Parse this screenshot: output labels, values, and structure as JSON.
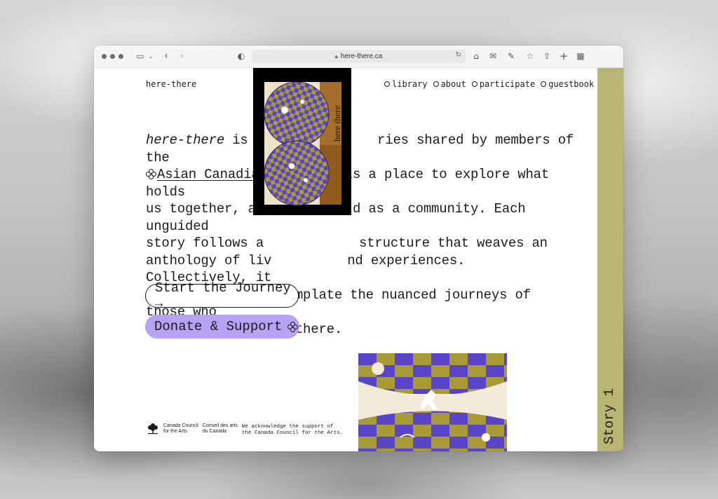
{
  "browser": {
    "url": "here-there.ca"
  },
  "header": {
    "site_name": "here-there",
    "nav": [
      {
        "label": "library"
      },
      {
        "label": "about"
      },
      {
        "label": "participate"
      },
      {
        "label": "guestbook"
      }
    ]
  },
  "intro": {
    "title_italic": "here-there",
    "part1": " is a",
    "part2": "ries shared by members of the",
    "link_text": "Asian Canadian",
    "part3": "is a place to explore what holds",
    "line3a": "us together, as",
    "line3b": "d as a community. Each unguided",
    "line4a": "story follows a",
    "line4b": "structure that weaves an",
    "line5a": "anthology of liv",
    "line5b": "nd experiences. Collectively, it",
    "line6": "is a space to contemplate the nuanced journeys of those who",
    "line7": "live both here and there."
  },
  "buttons": {
    "journey": "Start the Journey →",
    "donate": "Donate & Support"
  },
  "poster": {
    "title": "here there"
  },
  "sponsor": {
    "en_line1": "Canada Council",
    "en_line2": "for the Arts",
    "fr_line1": "Conseil des arts",
    "fr_line2": "du Canada",
    "ack_line1": "We acknowledge the support of",
    "ack_line2": "the Canada Council for the Arts."
  },
  "side": {
    "story_label": "Story 1"
  },
  "colors": {
    "accent_purple": "#b7a3f3",
    "strip_olive": "#b9b574",
    "art_purple": "#5a45c9",
    "art_gold": "#a89a36",
    "art_cream": "#f3ead9"
  }
}
